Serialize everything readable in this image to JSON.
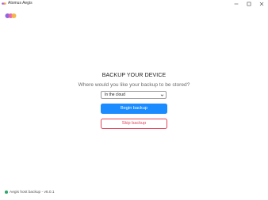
{
  "window": {
    "title": "Atomus Aegis"
  },
  "main": {
    "heading": "BACKUP YOUR DEVICE",
    "subheading": "Where would you like your backup to be stored?",
    "select": {
      "selected": "In the cloud"
    },
    "begin_button": "Begin backup",
    "skip_button": "Skip backup"
  },
  "footer": {
    "status_text": "Aegis host backup - v6.0.1",
    "status_color": "#2ea76a"
  },
  "colors": {
    "accent": "#1a8cff",
    "danger": "#e0485b"
  }
}
